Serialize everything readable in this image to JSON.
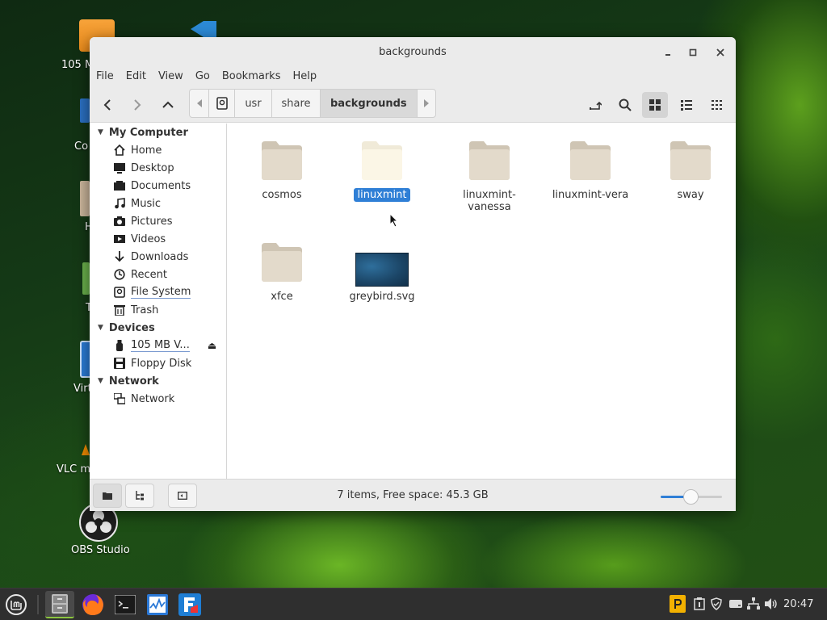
{
  "desktop": {
    "icons": [
      {
        "label": "105 M"
      },
      {
        "label": "Co"
      },
      {
        "label": "H"
      },
      {
        "label": "T"
      },
      {
        "label": "Virt"
      },
      {
        "label": "VLC me"
      },
      {
        "label": "OBS Studio"
      }
    ]
  },
  "window": {
    "title": "backgrounds",
    "menu": [
      "File",
      "Edit",
      "View",
      "Go",
      "Bookmarks",
      "Help"
    ],
    "path": [
      "usr",
      "share",
      "backgrounds"
    ]
  },
  "sidebar": {
    "sections": [
      {
        "title": "My Computer",
        "items": [
          {
            "label": "Home",
            "icon": "home-icon"
          },
          {
            "label": "Desktop",
            "icon": "desktop-icon"
          },
          {
            "label": "Documents",
            "icon": "documents-icon"
          },
          {
            "label": "Music",
            "icon": "music-icon"
          },
          {
            "label": "Pictures",
            "icon": "pictures-icon"
          },
          {
            "label": "Videos",
            "icon": "videos-icon"
          },
          {
            "label": "Downloads",
            "icon": "downloads-icon"
          },
          {
            "label": "Recent",
            "icon": "recent-icon"
          },
          {
            "label": "File System",
            "icon": "filesystem-icon"
          },
          {
            "label": "Trash",
            "icon": "trash-icon"
          }
        ]
      },
      {
        "title": "Devices",
        "items": [
          {
            "label": "105 MB V...",
            "icon": "usb-drive-icon"
          },
          {
            "label": "Floppy Disk",
            "icon": "floppy-icon"
          }
        ]
      },
      {
        "title": "Network",
        "items": [
          {
            "label": "Network",
            "icon": "network-icon"
          }
        ]
      }
    ]
  },
  "files": [
    {
      "name": "cosmos",
      "type": "folder"
    },
    {
      "name": "linuxmint",
      "type": "folder",
      "selected": true
    },
    {
      "name": "linuxmint-vanessa",
      "type": "folder"
    },
    {
      "name": "linuxmint-vera",
      "type": "folder"
    },
    {
      "name": "sway",
      "type": "folder"
    },
    {
      "name": "xfce",
      "type": "folder"
    },
    {
      "name": "greybird.svg",
      "type": "image"
    }
  ],
  "status": {
    "text": "7 items, Free space: 45.3 GB",
    "zoom_level": 0.5
  },
  "taskbar": {
    "clock": "20:47"
  },
  "colors": {
    "selection": "#2f7fd6",
    "folder": "#e3dacb",
    "mint_accent": "#8cc63f"
  }
}
